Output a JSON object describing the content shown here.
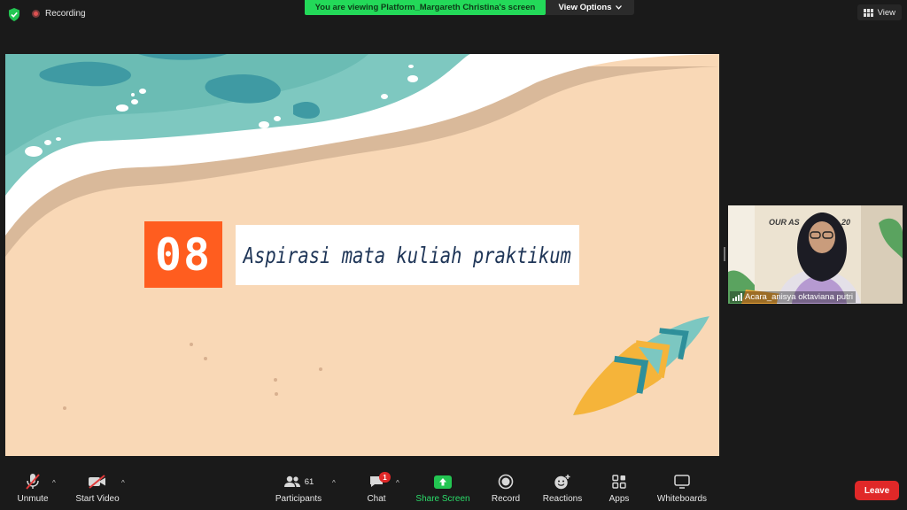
{
  "topbar": {
    "recording_label": "Recording",
    "viewing_banner": "You are viewing Platform_Margareth Christina's screen",
    "view_options_label": "View Options",
    "view_label": "View"
  },
  "slide": {
    "number": "08",
    "title": "Aspirasi mata kuliah praktikum"
  },
  "participant_thumb": {
    "name": "Acara_anisya oktaviana putri",
    "background_text": "OUR AS",
    "background_text_2": "20"
  },
  "toolbar": {
    "unmute_label": "Unmute",
    "start_video_label": "Start Video",
    "participants_label": "Participants",
    "participants_count": "61",
    "chat_label": "Chat",
    "chat_badge": "1",
    "share_screen_label": "Share Screen",
    "record_label": "Record",
    "reactions_label": "Reactions",
    "apps_label": "Apps",
    "whiteboards_label": "Whiteboards",
    "leave_label": "Leave"
  },
  "colors": {
    "banner_green": "#23d959",
    "leave_red": "#e02828",
    "slide_sand": "#f9d8b6",
    "number_orange": "#ff5d1f",
    "title_navy": "#1e3557",
    "sea_teal": "#6fc1b9"
  },
  "icons": [
    "shield-icon",
    "record-dot-icon",
    "chevron-down-icon",
    "grid-view-icon",
    "microphone-muted-icon",
    "video-muted-icon",
    "participants-icon",
    "chat-icon",
    "share-screen-icon",
    "record-icon",
    "reactions-icon",
    "apps-icon",
    "whiteboard-icon",
    "signal-bars-icon"
  ]
}
